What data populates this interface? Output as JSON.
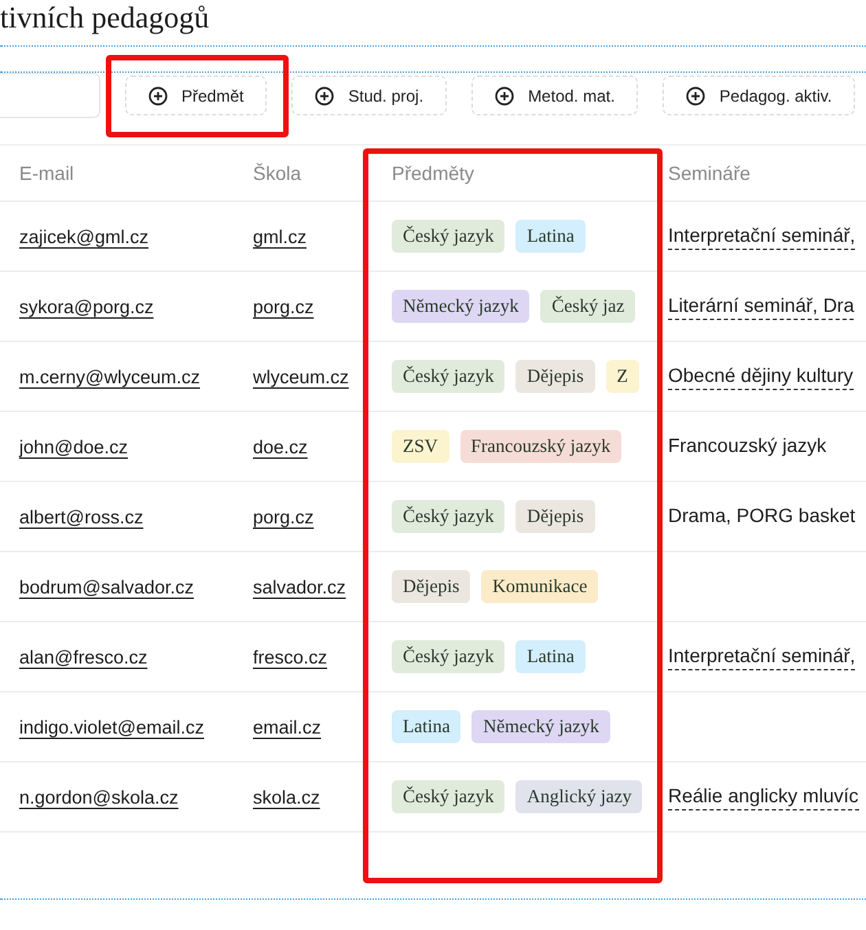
{
  "page": {
    "title": "tivních pedagogů"
  },
  "toolbar": {
    "buttons": [
      {
        "label": "Předmět",
        "highlighted": true
      },
      {
        "label": "Stud. proj.",
        "highlighted": false
      },
      {
        "label": "Metod. mat.",
        "highlighted": false
      },
      {
        "label": "Pedagog. aktiv.",
        "highlighted": false
      }
    ]
  },
  "table": {
    "columns": [
      {
        "label": "E-mail",
        "highlighted": false
      },
      {
        "label": "Škola",
        "highlighted": false
      },
      {
        "label": "Předměty",
        "highlighted": true
      },
      {
        "label": "Semináře",
        "highlighted": false
      }
    ],
    "rows": [
      {
        "email": "zajicek@gml.cz",
        "school": "gml.cz",
        "subjects": [
          {
            "label": "Český jazyk",
            "color": "#e0ebdc"
          },
          {
            "label": "Latina",
            "color": "#d3eefc"
          }
        ],
        "seminars": {
          "text": "Interpretační seminář,",
          "linked": true
        }
      },
      {
        "email": "sykora@porg.cz",
        "school": "porg.cz",
        "subjects": [
          {
            "label": "Německý jazyk",
            "color": "#ddd7f4"
          },
          {
            "label": "Český jaz",
            "color": "#e0ebdc"
          }
        ],
        "seminars": {
          "text": "Literární seminář, Dra",
          "linked": true
        }
      },
      {
        "email": "m.cerny@wlyceum.cz",
        "school": "wlyceum.cz",
        "subjects": [
          {
            "label": "Český jazyk",
            "color": "#e0ebdc"
          },
          {
            "label": "Dějepis",
            "color": "#ebe6e0"
          },
          {
            "label": "Z",
            "color": "#fcf3cf"
          }
        ],
        "seminars": {
          "text": "Obecné dějiny kultury",
          "linked": true
        }
      },
      {
        "email": "john@doe.cz",
        "school": "doe.cz",
        "subjects": [
          {
            "label": "ZSV",
            "color": "#fcf3cf"
          },
          {
            "label": "Francouzský jazyk",
            "color": "#f6dcd6"
          }
        ],
        "seminars": {
          "text": "Francouzský jazyk",
          "linked": false
        }
      },
      {
        "email": "albert@ross.cz",
        "school": "porg.cz",
        "subjects": [
          {
            "label": "Český jazyk",
            "color": "#e0ebdc"
          },
          {
            "label": "Dějepis",
            "color": "#ebe6e0"
          }
        ],
        "seminars": {
          "text": "Drama, PORG basket",
          "linked": false
        }
      },
      {
        "email": "bodrum@salvador.cz",
        "school": "salvador.cz",
        "subjects": [
          {
            "label": "Dějepis",
            "color": "#ebe6e0"
          },
          {
            "label": "Komunikace",
            "color": "#fcebc9"
          }
        ]
      },
      {
        "email": "alan@fresco.cz",
        "school": "fresco.cz",
        "subjects": [
          {
            "label": "Český jazyk",
            "color": "#e0ebdc"
          },
          {
            "label": "Latina",
            "color": "#d3eefc"
          }
        ],
        "seminars": {
          "text": "Interpretační seminář,",
          "linked": true
        }
      },
      {
        "email": "indigo.violet@email.cz",
        "school": "email.cz",
        "subjects": [
          {
            "label": "Latina",
            "color": "#d3eefc"
          },
          {
            "label": "Německý jazyk",
            "color": "#ddd7f4"
          }
        ]
      },
      {
        "email": "n.gordon@skola.cz",
        "school": "skola.cz",
        "subjects": [
          {
            "label": "Český jazyk",
            "color": "#e0ebdc"
          },
          {
            "label": "Anglický jazy",
            "color": "#e0e2ec"
          }
        ],
        "seminars": {
          "text": "Reálie anglicky mluvíc",
          "linked": true
        }
      }
    ]
  }
}
